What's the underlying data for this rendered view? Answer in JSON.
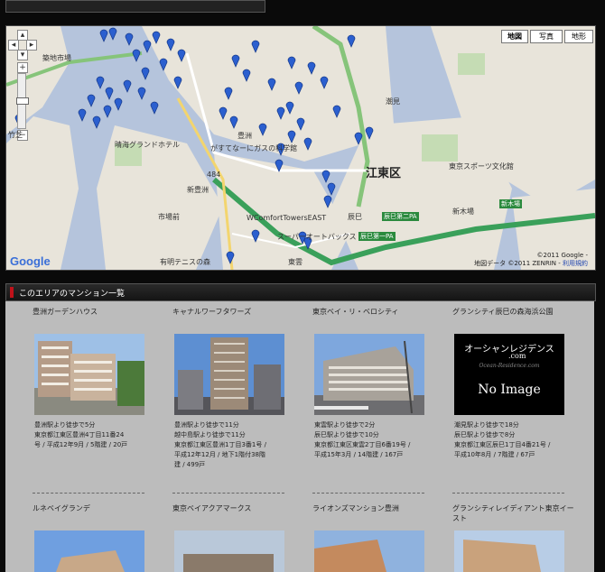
{
  "map": {
    "map_types": [
      "地図",
      "写真",
      "地形"
    ],
    "labels": {
      "tsukiji": "築地市場",
      "chiiki": "竹芝",
      "toyosu": "豊洲",
      "shintoyosu": "新豊洲",
      "ichibamae": "市場前",
      "koto": "江東区",
      "tatsumi": "辰巳",
      "shinkiba": "新木場",
      "shiomi": "潮見",
      "ariake": "有明テニスの森",
      "shinonome": "東雲",
      "jct1": "辰巳第二PA",
      "jct2": "辰巳第一PA",
      "shinkiba2": "新木場",
      "wcomfort": "WComfortTowersEAST",
      "super": "スーパーオートバックス",
      "ganz": "がすてなーにガスの科学館",
      "hotel": "晴海グランドホテル",
      "sparkle": "東京スポーツ文化館",
      "route": "484"
    },
    "attribution": "©2011 Google -",
    "attribution2": "地図データ ©2011 ZENRIN -",
    "terms_link": "利用規約",
    "logo": "Google"
  },
  "section": {
    "title": "このエリアのマンション一覧"
  },
  "listings": [
    {
      "name": "豊洲ガーデンハウス",
      "lines": [
        "豊洲駅より徒歩で5分",
        "東京都江東区豊洲4丁目11番24",
        "号 / 平成12年9月 / 5階建 / 20戸"
      ]
    },
    {
      "name": "キャナルワーフタワーズ",
      "lines": [
        "豊洲駅より徒歩で11分",
        "越中島駅より徒歩で11分",
        "東京都江東区豊洲1丁目3番1号 /",
        "平成12年12月 / 地下1階付38階",
        "建 / 499戸"
      ]
    },
    {
      "name": "東京ベイ・リ・ベロシティ",
      "lines": [
        "東雲駅より徒歩で2分",
        "辰巳駅より徒歩で10分",
        "東京都江東区東雲2丁目6番19号 /",
        "平成15年3月 / 14階建 / 167戸"
      ]
    },
    {
      "name": "グランシティ辰巳の森海浜公園",
      "no_image": {
        "brand": "オーシャンレジデンス",
        "sub": ".com",
        "script": "Ocean-Residence.com",
        "label": "No Image"
      },
      "lines": [
        "潮見駅より徒歩で18分",
        "辰巳駅より徒歩で8分",
        "東京都江東区辰巳1丁目4番21号 /",
        "平成10年8月 / 7階建 / 67戸"
      ]
    },
    {
      "name": "ルネベイグランデ"
    },
    {
      "name": "東京ベイアクアマークス"
    },
    {
      "name": "ライオンズマンション豊洲"
    },
    {
      "name": "グランシティレイディアント東京イースト"
    }
  ]
}
